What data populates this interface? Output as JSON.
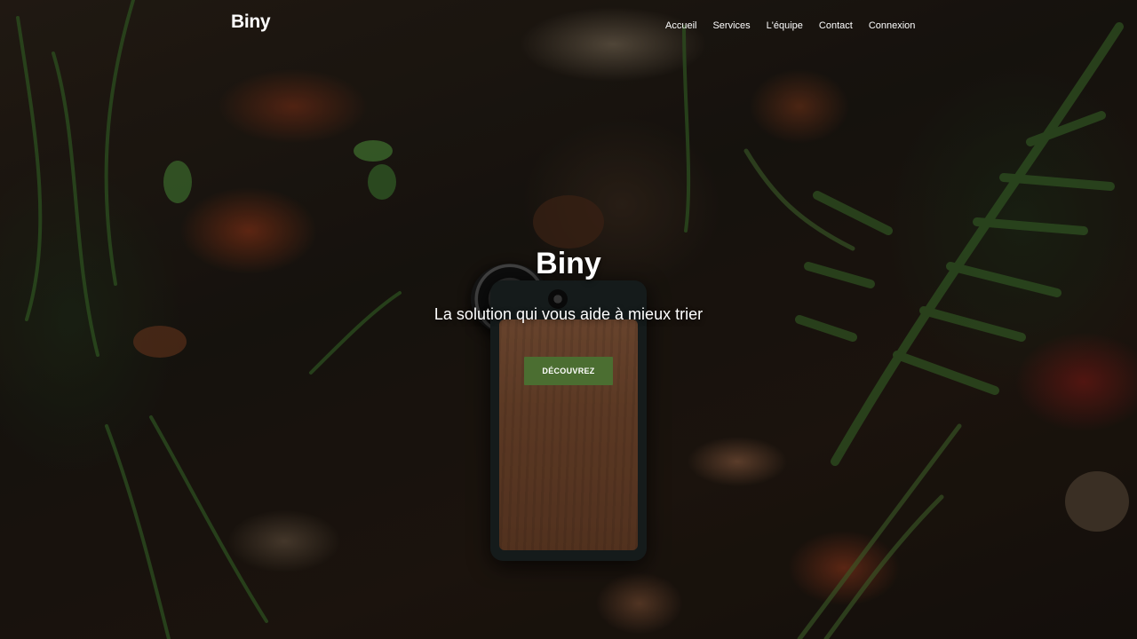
{
  "navbar": {
    "brand": "Biny",
    "links": [
      {
        "label": "Accueil"
      },
      {
        "label": "Services"
      },
      {
        "label": "L'équipe"
      },
      {
        "label": "Contact"
      },
      {
        "label": "Connexion"
      }
    ]
  },
  "hero": {
    "title": "Biny",
    "subtitle": "La solution qui vous aide à mieux trier",
    "cta_label": "DÉCOUVREZ",
    "background": "dark forest floor with autumn leaves, ferns and a wood-backed phone with clip-on lens"
  },
  "colors": {
    "cta_background": "#4b6e31",
    "text": "#ffffff"
  }
}
